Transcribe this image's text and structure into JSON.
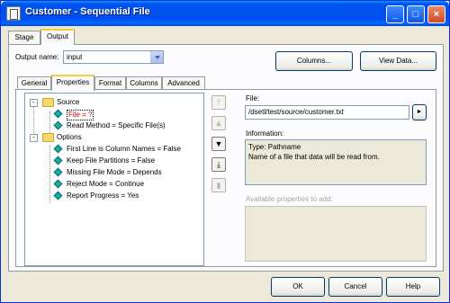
{
  "window": {
    "title": "Customer - Sequential File"
  },
  "outer_tabs": [
    "Stage",
    "Output"
  ],
  "output_name": {
    "label": "Output name:",
    "value": "input"
  },
  "buttons": {
    "columns": "Columns...",
    "view_data": "View Data...",
    "ok": "OK",
    "cancel": "Cancel",
    "help": "Help"
  },
  "inner_tabs": [
    "General",
    "Properties",
    "Format",
    "Columns",
    "Advanced"
  ],
  "tree": {
    "groups": [
      {
        "label": "Source",
        "items": [
          "File = ?",
          "Read Method = Specific File(s)"
        ]
      },
      {
        "label": "Options",
        "items": [
          "First Line is Column Names = False",
          "Keep File Partitions = False",
          "Missing File Mode = Depends",
          "Reject Mode = Continue",
          "Report Progress = Yes"
        ]
      }
    ]
  },
  "file_panel": {
    "label": "File:",
    "value": "/dsetl/test/source/customer.txt",
    "info_label": "Information:",
    "info_lines": [
      "Type: Pathname",
      "Name of a file that data will be read from."
    ],
    "available_label": "Available properties to add:"
  },
  "colors": {
    "error_text": "#d40000",
    "accent_tab": "#ffc83c"
  }
}
